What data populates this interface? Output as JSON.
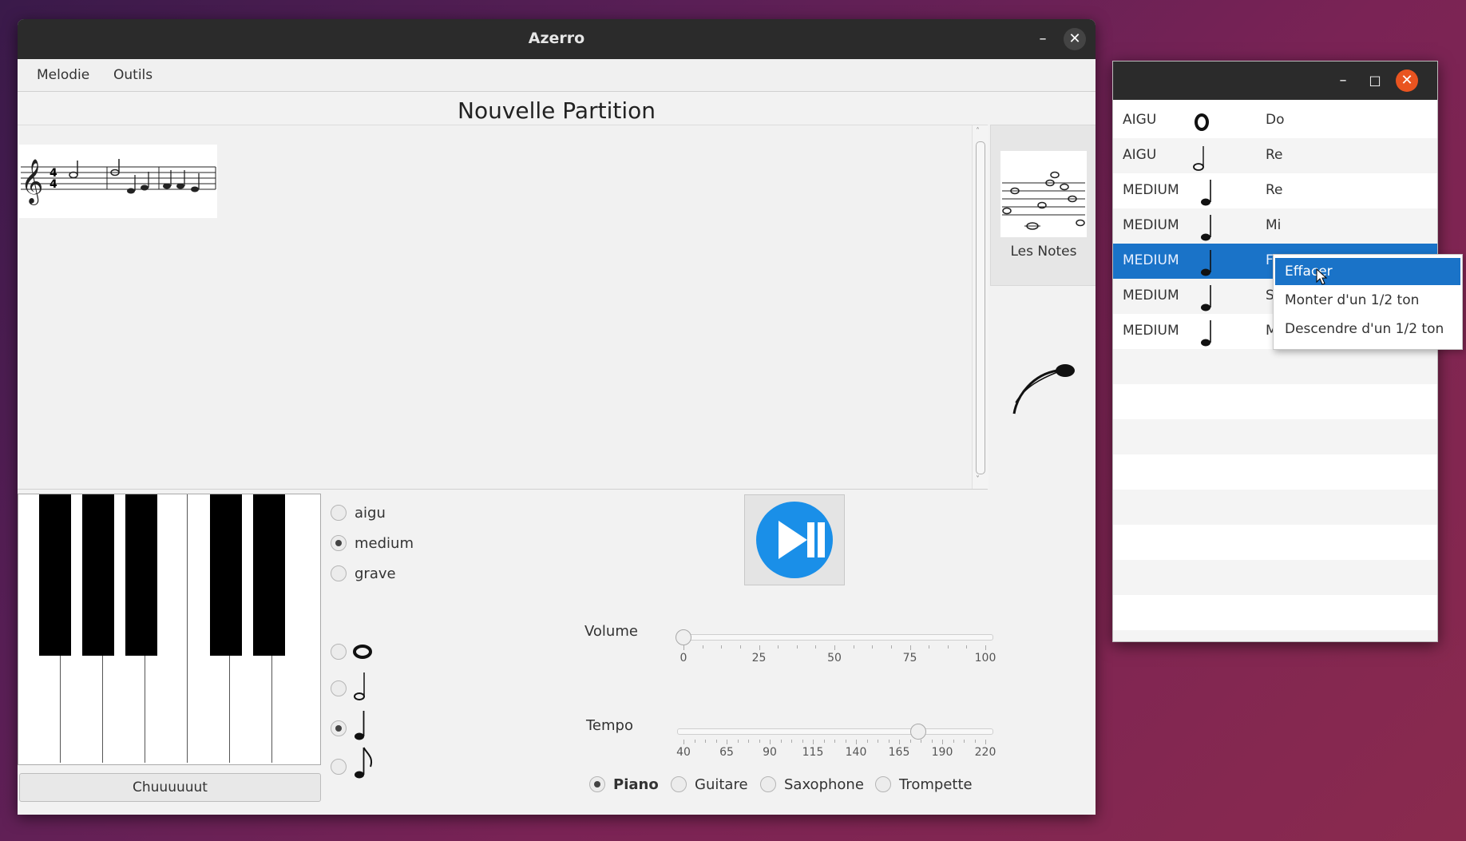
{
  "main_window": {
    "title": "Azerro",
    "minimize": "–",
    "close": "✕",
    "menu": [
      "Melodie",
      "Outils"
    ],
    "document_title": "Nouvelle Partition",
    "notes_panel_label": "Les Notes",
    "octave_options": [
      {
        "label": "aigu",
        "checked": false
      },
      {
        "label": "medium",
        "checked": true
      },
      {
        "label": "grave",
        "checked": false
      }
    ],
    "duration_options": [
      {
        "icon": "whole-note-icon",
        "checked": false
      },
      {
        "icon": "half-note-icon",
        "checked": false
      },
      {
        "icon": "quarter-note-icon",
        "checked": true
      },
      {
        "icon": "eighth-note-icon",
        "checked": false
      }
    ],
    "silence_button": "Chuuuuuut",
    "volume": {
      "label": "Volume",
      "value": 0,
      "ticks": [
        "0",
        "25",
        "50",
        "75",
        "100"
      ]
    },
    "tempo": {
      "label": "Tempo",
      "value": 180,
      "ticks": [
        "40",
        "65",
        "90",
        "115",
        "140",
        "165",
        "190",
        "220"
      ]
    },
    "instruments": [
      {
        "label": "Piano",
        "checked": true
      },
      {
        "label": "Guitare",
        "checked": false
      },
      {
        "label": "Saxophone",
        "checked": false
      },
      {
        "label": "Trompette",
        "checked": false
      }
    ],
    "accent_color": "#1a8fe8"
  },
  "list_window": {
    "minimize": "–",
    "maximize": "□",
    "close": "✕",
    "rows": [
      {
        "octave": "AIGU",
        "icon": "whole-note-icon",
        "note": "Do",
        "selected": false
      },
      {
        "octave": "AIGU",
        "icon": "half-note-icon",
        "note": "Re",
        "selected": false
      },
      {
        "octave": "MEDIUM",
        "icon": "quarter-note-icon",
        "note": "Re",
        "selected": false
      },
      {
        "octave": "MEDIUM",
        "icon": "quarter-note-icon",
        "note": "Mi",
        "selected": false
      },
      {
        "octave": "MEDIUM",
        "icon": "quarter-note-icon",
        "note": "F",
        "selected": true
      },
      {
        "octave": "MEDIUM",
        "icon": "quarter-note-icon",
        "note": "S",
        "selected": false
      },
      {
        "octave": "MEDIUM",
        "icon": "quarter-note-icon",
        "note": "M",
        "selected": false
      }
    ],
    "context_menu": [
      "Effacer",
      "Monter d'un 1/2 ton",
      "Descendre d'un 1/2 ton"
    ],
    "selection_color": "#1a73c8"
  }
}
